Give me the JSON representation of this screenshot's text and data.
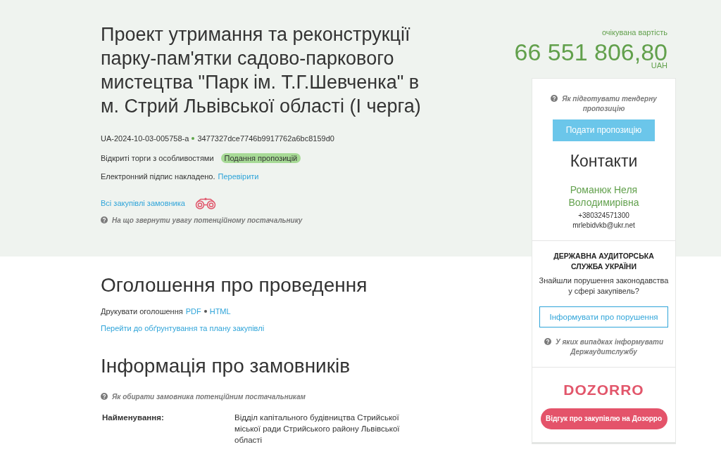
{
  "tender": {
    "title": "Проект утримання та реконструкції парку-пам'ятки садово-паркового мистецтва \"Парк ім. Т.Г.Шевченка\" в м. Стрий Львівської області (I черга)",
    "id": "UA-2024-10-03-005758-a",
    "hash": "3477327dce7746b9917762a6bc8159d0",
    "procedure_type": "Відкриті торги з особливостями",
    "status_badge": "Подання пропозицій",
    "signature": {
      "text": "Електронний підпис накладено.",
      "link": "Перевірити"
    },
    "buyer_link": "Всі закупівлі замовника",
    "help_link": "На що звернути увагу потенційному постачальнику"
  },
  "value": {
    "label": "очікувана вартість",
    "amount": "66 551 806,80",
    "currency": "UAH"
  },
  "sidebar": {
    "help_link": "Як підготувати тендерну пропозицію",
    "submit_button": "Подати пропозицію",
    "contacts": {
      "heading": "Контакти",
      "name": "Романюк Неля Володимирівна",
      "phone": "+380324571300",
      "email": "mrlebidvkb@ukr.net"
    },
    "audit": {
      "title": "ДЕРЖАВНА АУДИТОРСЬКА СЛУЖБА УКРАЇНИ",
      "question": "Знайшли порушення законодавства у сфері закупівель?",
      "button": "Інформувати про порушення",
      "help_link": "У яких випадках інформувати Держаудитслужбу"
    },
    "dozorro": {
      "logo": "DOZORRO",
      "button": "Відгук про закупівлю на Дозорро"
    }
  },
  "announcement": {
    "heading": "Оголошення про проведення",
    "print_label": "Друкувати оголошення",
    "print_links": [
      "PDF",
      "HTML"
    ],
    "plan_link": "Перейти до обґрунтування та плану закупівлі"
  },
  "buyers": {
    "heading": "Інформація про замовників",
    "help_link": "Як обирати замовника потенційним постачальникам",
    "fields": [
      {
        "label": "Найменування:",
        "value": "Відділ капітального будівництва Стрийської міської ради Стрийського району Львівської області"
      }
    ]
  }
}
